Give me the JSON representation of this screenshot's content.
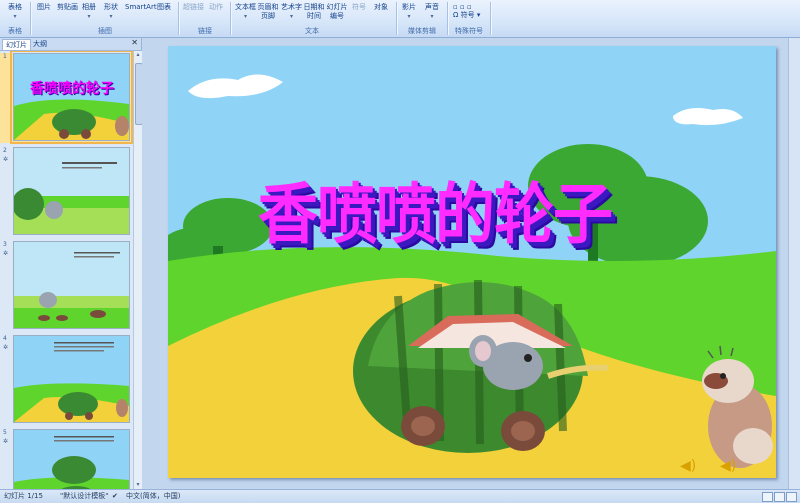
{
  "ribbon": {
    "groups": [
      {
        "label": "表格",
        "buttons": [
          {
            "label": "表格"
          }
        ]
      },
      {
        "label": "插图",
        "buttons": [
          {
            "label": "图片"
          },
          {
            "label": "剪贴画"
          },
          {
            "label": "相册"
          },
          {
            "label": "形状"
          },
          {
            "label": "SmartArt"
          },
          {
            "label": "图表"
          }
        ]
      },
      {
        "label": "链接",
        "buttons": [
          {
            "label": "超链接"
          },
          {
            "label": "动作"
          }
        ]
      },
      {
        "label": "文本",
        "buttons": [
          {
            "label": "文本框"
          },
          {
            "label": "页眉和页脚"
          },
          {
            "label": "艺术字"
          },
          {
            "label": "日期和时间"
          },
          {
            "label": "幻灯片编号"
          },
          {
            "label": "符号"
          },
          {
            "label": "对象"
          }
        ]
      },
      {
        "label": "媒体剪辑",
        "buttons": [
          {
            "label": "影片"
          },
          {
            "label": "声音"
          }
        ]
      },
      {
        "label": "特殊符号",
        "buttons": [
          {
            "label": "符号"
          }
        ]
      }
    ]
  },
  "panel": {
    "tabs": [
      "幻灯片",
      "大纲"
    ],
    "slides": [
      {
        "num": "1",
        "title": "香喷喷的轮子",
        "selected": true
      },
      {
        "num": "2",
        "title": "",
        "selected": false
      },
      {
        "num": "3",
        "title": "",
        "selected": false
      },
      {
        "num": "4",
        "title": "",
        "selected": false
      },
      {
        "num": "5",
        "title": "",
        "selected": false
      }
    ]
  },
  "slide": {
    "title": "香喷喷的轮子"
  },
  "status": {
    "slide_count": "幻灯片 1/15",
    "theme": "\"默认设计模板\"",
    "language": "中文(简体，中国)"
  },
  "colors": {
    "title": "#ff2bff",
    "title_shadow": "#3b19c0",
    "sky": "#8fd4f6",
    "grass": "#5fd42c",
    "road": "#f2d13a"
  }
}
